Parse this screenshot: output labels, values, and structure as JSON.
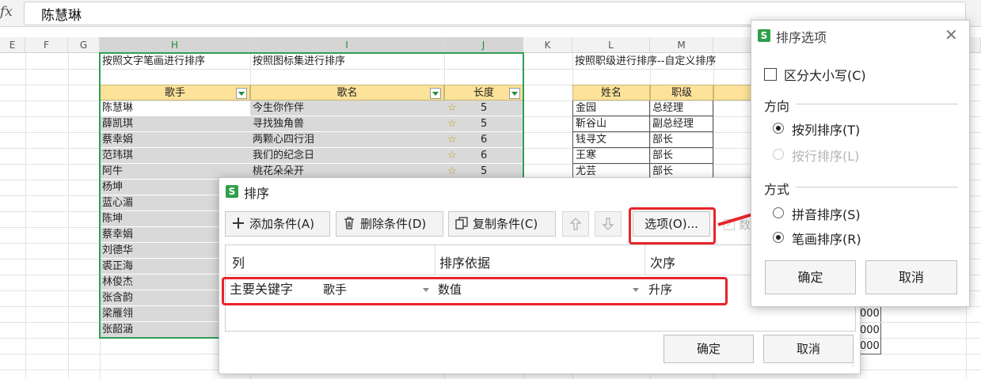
{
  "formula_bar": {
    "fx_label": "fx",
    "value": "陈慧琳"
  },
  "columns": [
    {
      "label": "E"
    },
    {
      "label": "F"
    },
    {
      "label": "G"
    },
    {
      "label": "H"
    },
    {
      "label": "I"
    },
    {
      "label": "J"
    },
    {
      "label": "K"
    },
    {
      "label": "L"
    },
    {
      "label": "M"
    }
  ],
  "sheet": {
    "title_h": "按照文字笔画进行排序",
    "title_i": "按照图标集进行排序",
    "title_l": "按照职级进行排序--自定义排序",
    "table1_headers": [
      "歌手",
      "歌名",
      "长度"
    ],
    "singers": [
      "陈慧琳",
      "薛凯琪",
      "蔡幸娟",
      "范玮琪",
      "阿牛",
      "杨坤",
      "蓝心湄",
      "陈坤",
      "蔡幸娟",
      "刘德华",
      "裘正海",
      "林俊杰",
      "张含韵",
      "梁雁翎",
      "张韶涵"
    ],
    "songs": [
      "今生你作伴",
      "寻找独角兽",
      "两颗心四行泪",
      "我们的纪念日",
      "桃花朵朵开"
    ],
    "lengths": [
      "5",
      "5",
      "6",
      "6",
      "5"
    ],
    "table2_headers": [
      "姓名",
      "职级"
    ],
    "names": [
      "金园",
      "靳谷山",
      "钱寻文",
      "王寒",
      "尤芸"
    ],
    "ranks": [
      "总经理",
      "副总经理",
      "部长",
      "部长",
      "部长"
    ],
    "right_values": [
      "000",
      "000",
      "000"
    ]
  },
  "sort_dialog": {
    "title": "排序",
    "add_condition": "添加条件(A)",
    "delete_condition": "删除条件(D)",
    "copy_condition": "复制条件(C)",
    "options_button": "选项(O)...",
    "partial_checkbox": "数",
    "col_header": "列",
    "basis_header": "排序依据",
    "order_header": "次序",
    "row_label": "主要关键字",
    "key_value": "歌手",
    "basis_value": "数值",
    "order_value": "升序",
    "ok": "确定",
    "cancel": "取消"
  },
  "options_dialog": {
    "title": "排序选项",
    "case_sensitive": "区分大小写(C)",
    "direction_heading": "方向",
    "by_column": "按列排序(T)",
    "by_row": "按行排序(L)",
    "method_heading": "方式",
    "pinyin": "拼音排序(S)",
    "stroke": "笔画排序(R)",
    "ok": "确定",
    "cancel": "取消"
  },
  "colors": {
    "accent_green": "#1e8e3e",
    "highlight_red": "#e8242a",
    "header_yellow": "#fde39a"
  }
}
